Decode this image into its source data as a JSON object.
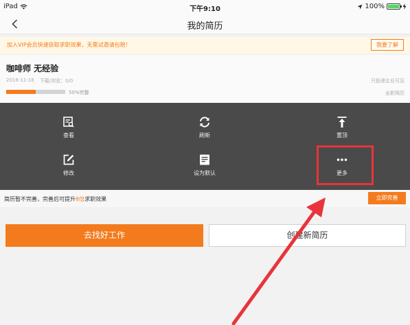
{
  "status_bar": {
    "device": "iPad",
    "time": "下午9:10",
    "battery": "100%"
  },
  "nav": {
    "title": "我的简历"
  },
  "vip_banner": {
    "text": "加入VIP会员快速获取求职效果，无需试邀请包赔！",
    "button": "我要了解"
  },
  "resume": {
    "title": "咖啡师 无经验",
    "date": "2018-11-18",
    "stats": "下载/浏览：0/0",
    "progress_label": "50%完整",
    "progress_fraction": 0.5,
    "visibility": "只投递企业可见",
    "job_scope": "全职简历"
  },
  "actions": {
    "view": "查看",
    "refresh": "刷新",
    "pin_top": "置顶",
    "edit": "修改",
    "set_default": "设为默认",
    "more": "更多"
  },
  "hint": {
    "text_before": "简历暂不完善，完善后可提升",
    "emphasis": "8倍",
    "text_after": "求职效果",
    "button": "立即完善"
  },
  "buttons": {
    "find_job": "去找好工作",
    "create_resume": "创建新简历"
  },
  "colors": {
    "accent": "#f37b1d",
    "panel": "#4a4a4a",
    "annotation": "#e8343a"
  }
}
